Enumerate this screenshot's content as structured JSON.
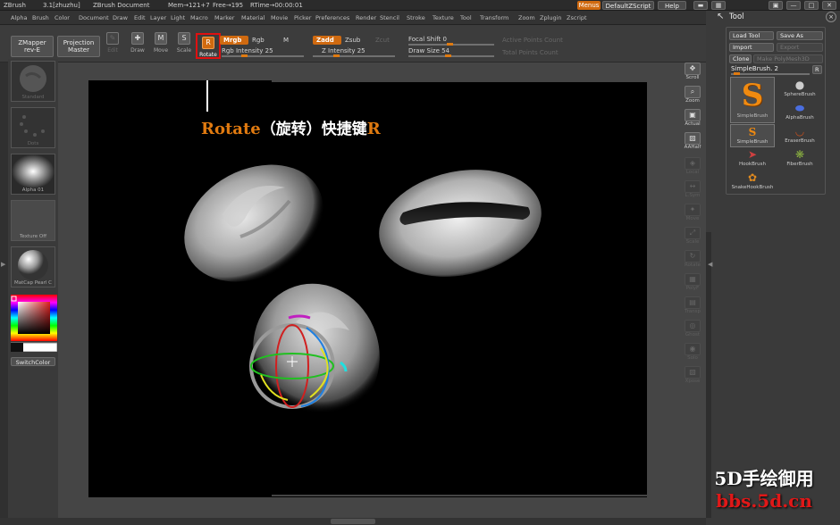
{
  "titlebar": {
    "app": "ZBrush",
    "version": "3.1[zhuzhu]",
    "document": "ZBrush Document",
    "mem": "Mem→121+7",
    "free": "Free→195",
    "rtime": "RTime→00:00:01",
    "menus": "Menus",
    "script": "DefaultZScript",
    "help": "Help"
  },
  "menu_items": [
    "Alpha",
    "Brush",
    "Color",
    "Document",
    "Draw",
    "Edit",
    "Layer",
    "Light",
    "Macro",
    "Marker",
    "Material",
    "Movie",
    "Picker",
    "Preferences",
    "Render",
    "Stencil",
    "Stroke",
    "Texture",
    "Tool",
    "Transform",
    "Zoom",
    "Zplugin",
    "Zscript"
  ],
  "shelf": {
    "zmapper": "ZMapper",
    "zmapper_sub": "rev-E",
    "projection": "Projection",
    "projection_sub": "Master",
    "edit": "Edit",
    "draw": "Draw",
    "move": "Move",
    "scale": "Scale",
    "rotate": "Rotate",
    "mrgb": "Mrgb",
    "rgb": "Rgb",
    "m": "M",
    "rgb_intensity": "Rgb Intensity 25",
    "zadd": "Zadd",
    "zsub": "Zsub",
    "zcut": "Zcut",
    "z_intensity": "Z Intensity 25",
    "focal_shift": "Focal Shift 0",
    "draw_size": "Draw Size 54",
    "active_points": "Active Points Count",
    "total_points": "Total Points Count"
  },
  "left_panel": {
    "standard": "Standard",
    "dots": "Dots",
    "alpha": "Alpha 01",
    "texture": "Texture Off",
    "matcap": "MatCap Pearl C",
    "switch_color": "SwitchColor"
  },
  "right_shelf": [
    "Scroll",
    "Zoom",
    "Actual",
    "AAHalf",
    "Local",
    "L.Sym",
    "Move",
    "Scale",
    "Rotate",
    "PolyF",
    "Transp",
    "Ghost",
    "Solo",
    "Xpose"
  ],
  "tool_panel": {
    "title": "Tool",
    "load_tool": "Load Tool",
    "save_as": "Save As",
    "import": "Import",
    "export": "Export",
    "clone": "Clone",
    "make_polymesh": "Make PolyMesh3D",
    "current": "SimpleBrush. 2",
    "r": "R",
    "brushes": [
      "SimpleBrush",
      "SphereBrush",
      "AlphaBrush",
      "SimpleBrush",
      "EraserBrush",
      "HookBrush",
      "FiberBrush",
      "SnakeHookBrush"
    ]
  },
  "annotation": {
    "label_en": "Rotate",
    "label_cn": "（旋转）快捷键",
    "key": "R"
  },
  "watermark": {
    "line1": "5D手绘御用",
    "line2": "bbs.5d.cn"
  },
  "colors": {
    "accent_orange": "#d06a10",
    "highlight_red": "#e01010"
  }
}
